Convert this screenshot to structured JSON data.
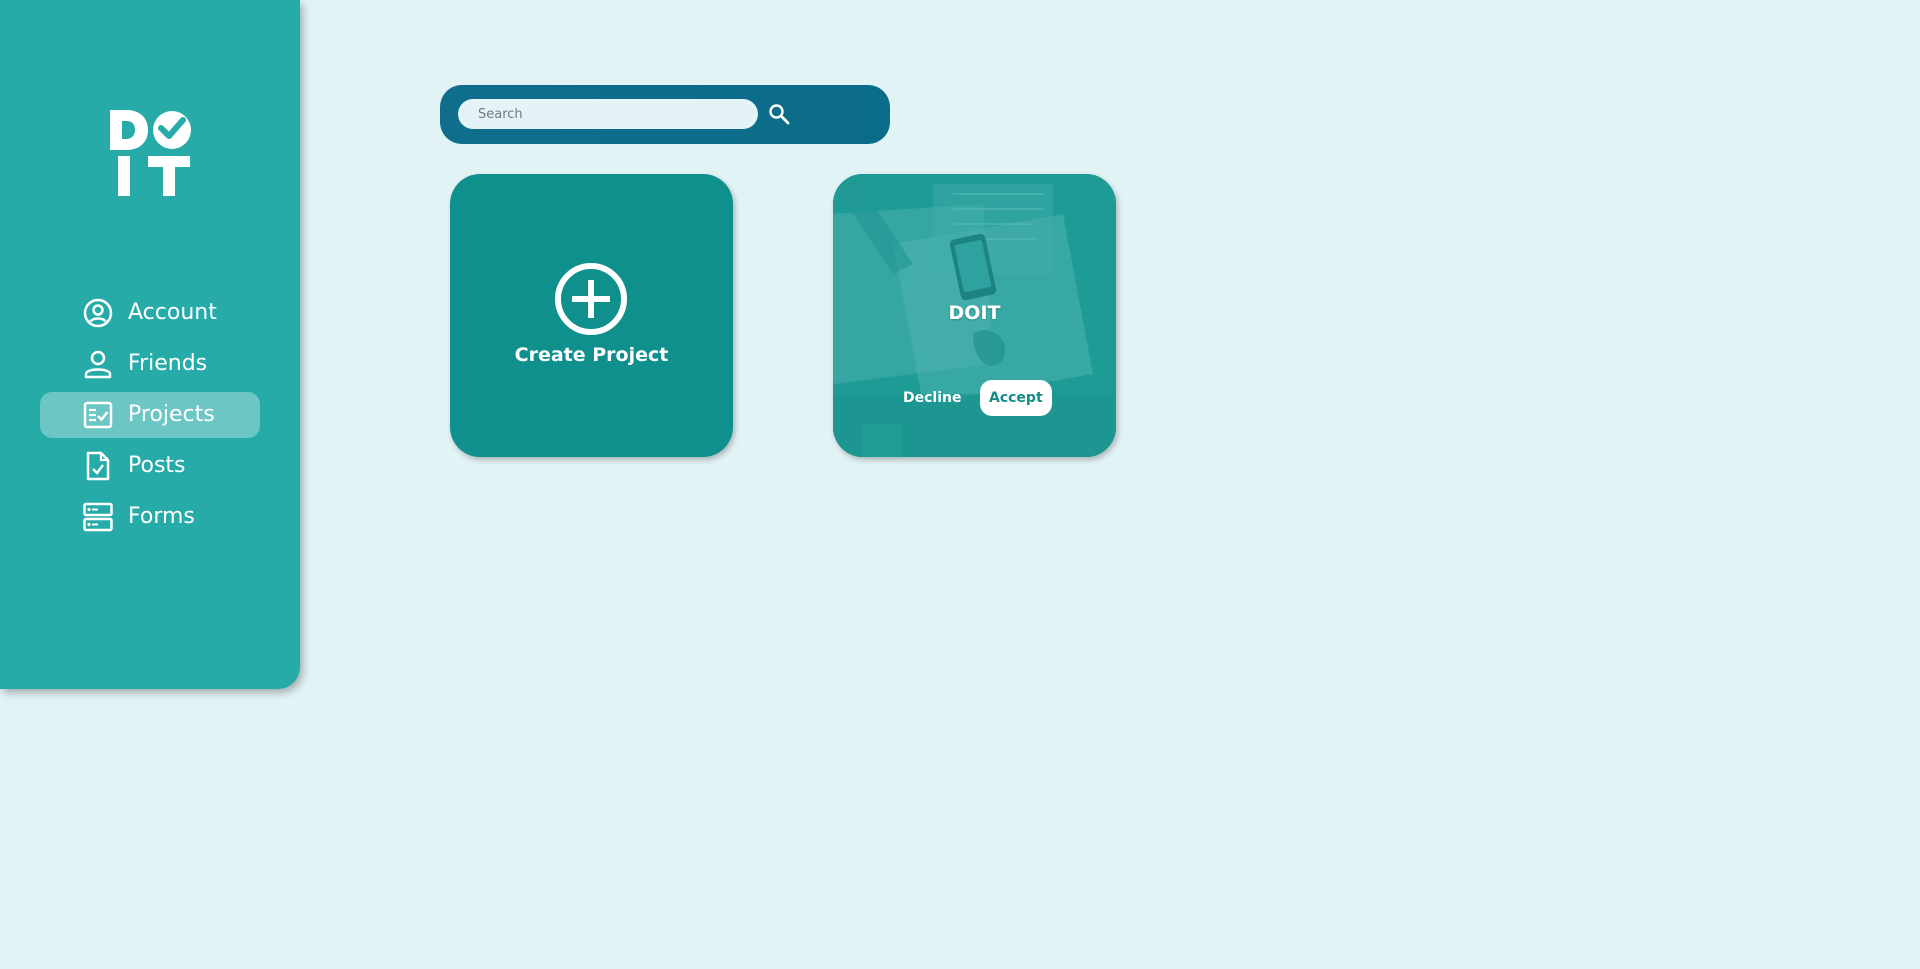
{
  "app": {
    "logo_text": "DOIT"
  },
  "sidebar": {
    "items": [
      {
        "label": "Account",
        "icon": "account-circle-icon",
        "active": false
      },
      {
        "label": "Friends",
        "icon": "person-icon",
        "active": false
      },
      {
        "label": "Projects",
        "icon": "checklist-icon",
        "active": true
      },
      {
        "label": "Posts",
        "icon": "document-check-icon",
        "active": false
      },
      {
        "label": "Forms",
        "icon": "form-icon",
        "active": false
      }
    ]
  },
  "search": {
    "placeholder": "Search",
    "value": ""
  },
  "cards": {
    "create": {
      "label": "Create Project"
    },
    "project": {
      "title": "DOIT",
      "decline_label": "Decline",
      "accept_label": "Accept"
    }
  },
  "colors": {
    "background": "#e2f3f6",
    "sidebar": "#26aba8",
    "search_bar": "#0e6d8b",
    "create_card": "#10908d",
    "accept_text": "#138c88"
  }
}
